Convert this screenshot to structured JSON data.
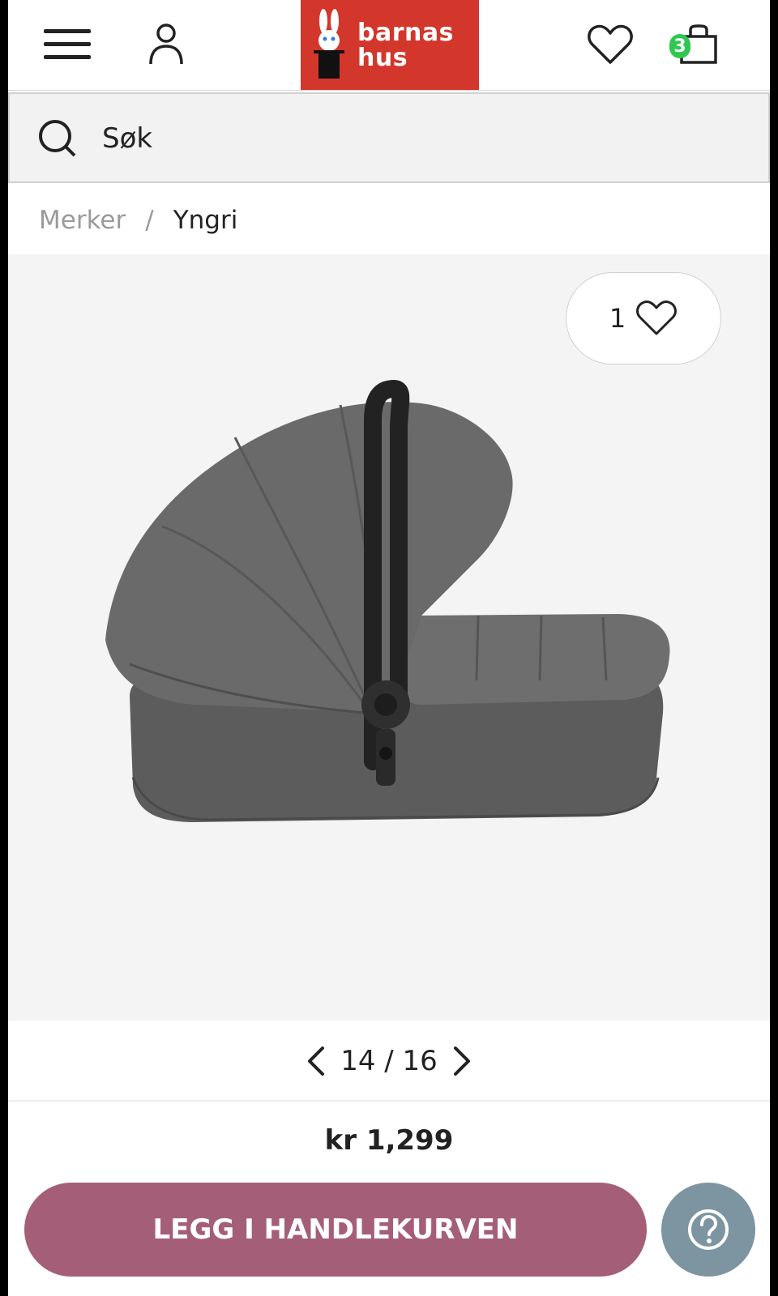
{
  "header": {
    "brand": "barnas hus",
    "brand_line1": "barnas",
    "brand_line2": "hus",
    "cart_count": "3",
    "logo_color": "#d3362b"
  },
  "search": {
    "placeholder": "Søk"
  },
  "breadcrumb": {
    "items": [
      "Merker",
      "Yngri"
    ],
    "separator": "/"
  },
  "product": {
    "like_count": "1",
    "image_counter": "14 / 16",
    "price": "kr 1,299"
  },
  "actions": {
    "add_to_cart": "LEGG I HANDLEKURVEN",
    "cta_color": "#a55e78",
    "help_color": "#7d95a0"
  },
  "icons": [
    "menu-icon",
    "user-icon",
    "heart-icon",
    "cart-icon",
    "search-icon",
    "chevron-left-icon",
    "chevron-right-icon",
    "help-icon"
  ]
}
